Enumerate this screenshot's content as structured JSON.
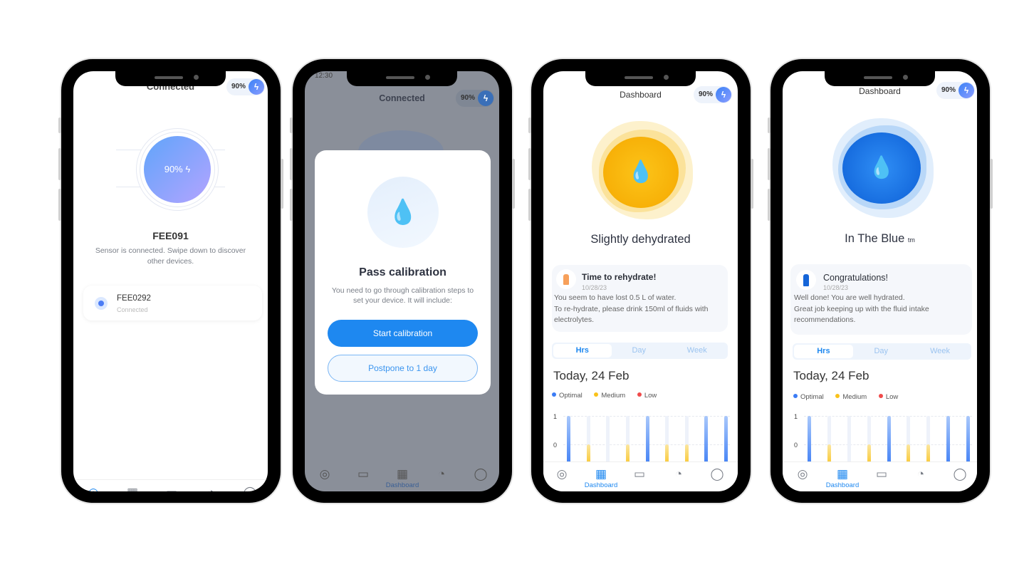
{
  "colors": {
    "accent": "#1e88f0",
    "optimal": "#3b7cf5",
    "medium": "#f9c21a",
    "low": "#f04b4b",
    "overlay": "#8a8f99"
  },
  "battery": "90%",
  "phone1": {
    "title": "Connected",
    "watch_battery": "90%",
    "device_name": "FEE091",
    "description": "Sensor is connected. Swipe down to discover other devices.",
    "device_list": [
      {
        "name": "FEE0292",
        "status": "Connected"
      }
    ]
  },
  "phone2": {
    "status_time": "12:30",
    "title": "Connected",
    "modal": {
      "title": "Pass calibration",
      "text": "You need to go through calibration steps to set your device. It will include:",
      "primary": "Start calibration",
      "secondary": "Postpone to 1 day"
    },
    "nav_active_label": "Dashboard"
  },
  "phone3": {
    "title": "Dashboard",
    "status": "Slightly dehydrated",
    "notice": {
      "title": "Time to rehydrate!",
      "date": "10/28/23",
      "line1": "You seem to have lost 0.5 L of water.",
      "line2": "To re-hydrate, please drink 150ml of fluids  with electrolytes."
    },
    "date_heading": "Today, 24 Feb",
    "nav_active_label": "Dashboard"
  },
  "phone4": {
    "title": "Dashboard",
    "status": "In The Blue",
    "status_suffix": "tm",
    "notice": {
      "title": "Congratulations!",
      "date": "10/28/23",
      "line1": "Well done! You are well hydrated.",
      "line2": "Great job keeping up with the fluid intake recommendations."
    },
    "date_heading": "Today, 24 Feb",
    "nav_active_label": "Dashboard"
  },
  "tabs": [
    "Hrs",
    "Day",
    "Week"
  ],
  "legend": [
    "Optimal",
    "Medium",
    "Low"
  ],
  "chart_data": {
    "type": "bar",
    "y_ticks": [
      "1",
      "0"
    ],
    "levels": [
      "optimal",
      "medium",
      "none",
      "medium",
      "optimal",
      "medium",
      "medium",
      "optimal",
      "optimal"
    ],
    "values": [
      1,
      0,
      null,
      0,
      1,
      0,
      0,
      1,
      1
    ],
    "grid": true
  }
}
